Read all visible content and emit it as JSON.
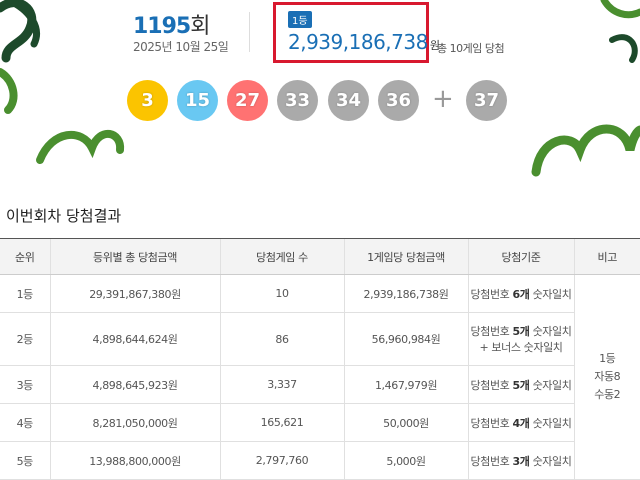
{
  "draw": {
    "round_number": "1195",
    "round_suffix": "회",
    "date": "2025년 10월 25일",
    "first_prize": {
      "badge": "1등",
      "amount": "2,939,186,738",
      "unit": "원",
      "note": "총 10게임 당첨"
    },
    "balls": [
      {
        "number": "3",
        "color": "#fbc400"
      },
      {
        "number": "15",
        "color": "#69c8f2"
      },
      {
        "number": "27",
        "color": "#ff7272"
      },
      {
        "number": "33",
        "color": "#aaaaaa"
      },
      {
        "number": "34",
        "color": "#aaaaaa"
      },
      {
        "number": "36",
        "color": "#aaaaaa"
      }
    ],
    "plus_symbol": "+",
    "bonus_ball": {
      "number": "37",
      "color": "#aaaaaa"
    }
  },
  "results": {
    "title": "이번회차 당첨결과",
    "headers": [
      "순위",
      "등위별 총 당첨금액",
      "당첨게임 수",
      "1게임당 당첨금액",
      "당첨기준",
      "비고"
    ],
    "rows": [
      {
        "rank": "1등",
        "total": "29,391,867,380원",
        "games": "10",
        "per_game": "2,939,186,738원",
        "crit_pre": "당첨번호 ",
        "crit_bold": "6개",
        "crit_post": " 숫자일치",
        "crit_line2": ""
      },
      {
        "rank": "2등",
        "total": "4,898,644,624원",
        "games": "86",
        "per_game": "56,960,984원",
        "crit_pre": "당첨번호 ",
        "crit_bold": "5개",
        "crit_post": " 숫자일치",
        "crit_line2": "+ 보너스 숫자일치"
      },
      {
        "rank": "3등",
        "total": "4,898,645,923원",
        "games": "3,337",
        "per_game": "1,467,979원",
        "crit_pre": "당첨번호 ",
        "crit_bold": "5개",
        "crit_post": " 숫자일치",
        "crit_line2": ""
      },
      {
        "rank": "4등",
        "total": "8,281,050,000원",
        "games": "165,621",
        "per_game": "50,000원",
        "crit_pre": "당첨번호 ",
        "crit_bold": "4개",
        "crit_post": " 숫자일치",
        "crit_line2": ""
      },
      {
        "rank": "5등",
        "total": "13,988,800,000원",
        "games": "2,797,760",
        "per_game": "5,000원",
        "crit_pre": "당첨번호 ",
        "crit_bold": "3개",
        "crit_post": " 숫자일치",
        "crit_line2": ""
      }
    ],
    "remark": {
      "line1": "1등",
      "line2": "자동8",
      "line3": "수동2"
    }
  },
  "colors": {
    "accent_blue": "#1a6fb5",
    "highlight_red": "#d8182f",
    "deco_green": "#4a8f2f",
    "deco_dark": "#1d4a2b"
  }
}
